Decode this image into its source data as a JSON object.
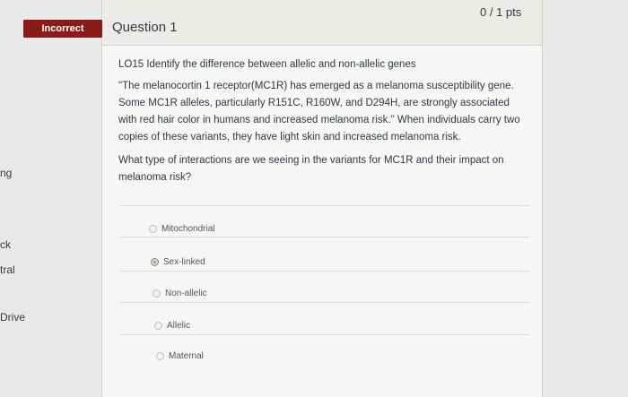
{
  "sidebar": {
    "frag1": "ng",
    "frag2": "ck",
    "frag3": "tral",
    "frag4": "Drive"
  },
  "question": {
    "status_badge": "Incorrect",
    "title": "Question 1",
    "points": "0 / 1 pts",
    "objective": "LO15 Identify the difference between allelic and non-allelic genes",
    "passage": "\"The melanocortin 1 receptor(MC1R) has emerged as a melanoma susceptibility gene. Some MC1R alleles, particularly R151C, R160W, and D294H, are strongly associated with red hair color in humans and increased melanoma risk.\" When individuals carry two copies of these variants, they have light skin and increased melanoma risk.",
    "prompt": "What type of interactions are we seeing in the variants for MC1R and their impact on melanoma risk?",
    "answers": [
      {
        "label": "Mitochondrial",
        "selected": false
      },
      {
        "label": "Sex-linked",
        "selected": true
      },
      {
        "label": "Non-allelic",
        "selected": false
      },
      {
        "label": "Allelic",
        "selected": false
      },
      {
        "label": "Maternal",
        "selected": false
      }
    ]
  }
}
